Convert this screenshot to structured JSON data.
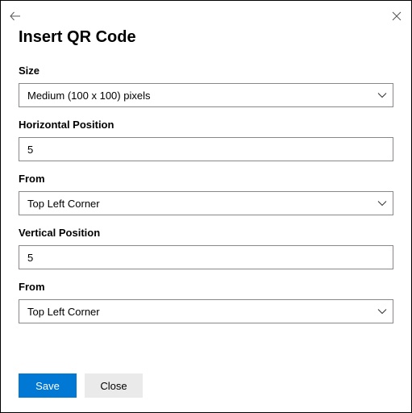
{
  "title": "Insert QR Code",
  "fields": {
    "size": {
      "label": "Size",
      "value": "Medium (100 x 100) pixels"
    },
    "horizontal_position": {
      "label": "Horizontal Position",
      "value": "5"
    },
    "horizontal_from": {
      "label": "From",
      "value": "Top Left Corner"
    },
    "vertical_position": {
      "label": "Vertical Position",
      "value": "5"
    },
    "vertical_from": {
      "label": "From",
      "value": "Top Left Corner"
    }
  },
  "buttons": {
    "save": "Save",
    "close": "Close"
  }
}
